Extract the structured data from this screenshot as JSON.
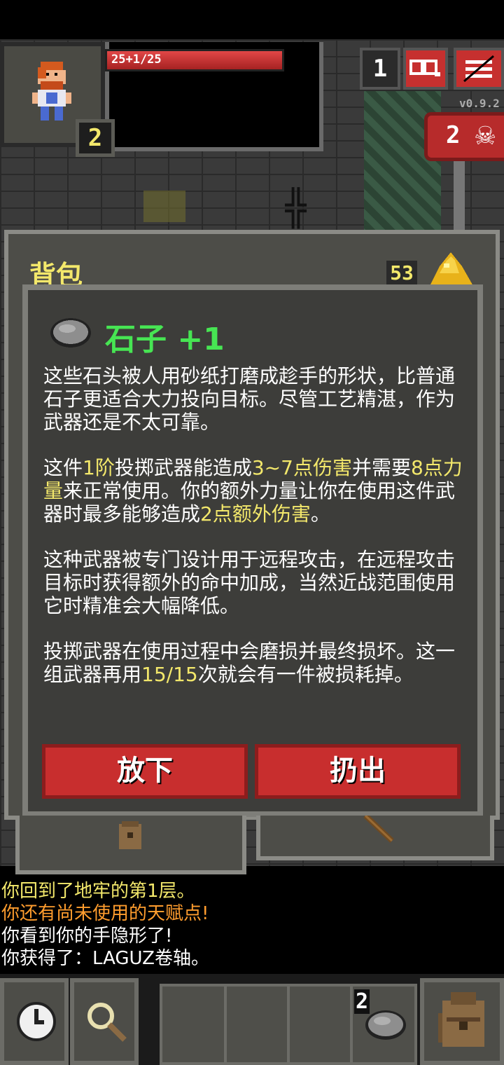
{
  "hud": {
    "hp_text": "25+1/25",
    "level": "2",
    "depth": "1",
    "version": "v0.9.2",
    "danger_count": "2",
    "search_icon": "magnifier-icon",
    "menu_icon": "menu-icon"
  },
  "backpack": {
    "title": "背包",
    "gold": "53"
  },
  "item": {
    "name": "石子 +1",
    "paragraphs": [
      [
        "这些石头被人用砂纸打磨成趁手的形状，比普通石子更适合大力投向目标。尽管工艺精湛，作为武器还是不太可靠。"
      ],
      [
        "这件",
        "1阶",
        "投掷武器能造成",
        "3~7点伤害",
        "并需要",
        "8点力量",
        "来正常使用。你的额外力量让你在使用这件武器时最多能够造成",
        "2点额外伤害",
        "。"
      ],
      [
        "这种武器被专门设计用于远程攻击，在远程攻击目标时获得额外的命中加成，当然近战范围使用它时精准会大幅降低。"
      ],
      [
        "投掷武器在使用过程中会磨损并最终损坏。这一组武器再用",
        "15/15",
        "次就会有一件被损耗掉。"
      ]
    ],
    "drop_label": "放下",
    "throw_label": "扔出"
  },
  "log": [
    {
      "text": "你回到了地牢的第1层。",
      "color": "#f3e86b"
    },
    {
      "text": "你还有尚未使用的天赋点!",
      "color": "#ff9d2e"
    },
    {
      "text": "你看到你的手隐形了!",
      "color": "#ffffff"
    },
    {
      "text": "你获得了：LAGUZ卷轴。",
      "color": "#ffffff"
    }
  ],
  "toolbar": {
    "quickslot_count": "2"
  },
  "colors": {
    "accent_red": "#c82e2e",
    "highlight_yellow": "#f3e86b",
    "item_green": "#47e553",
    "panel_bg": "#4d4d48"
  }
}
